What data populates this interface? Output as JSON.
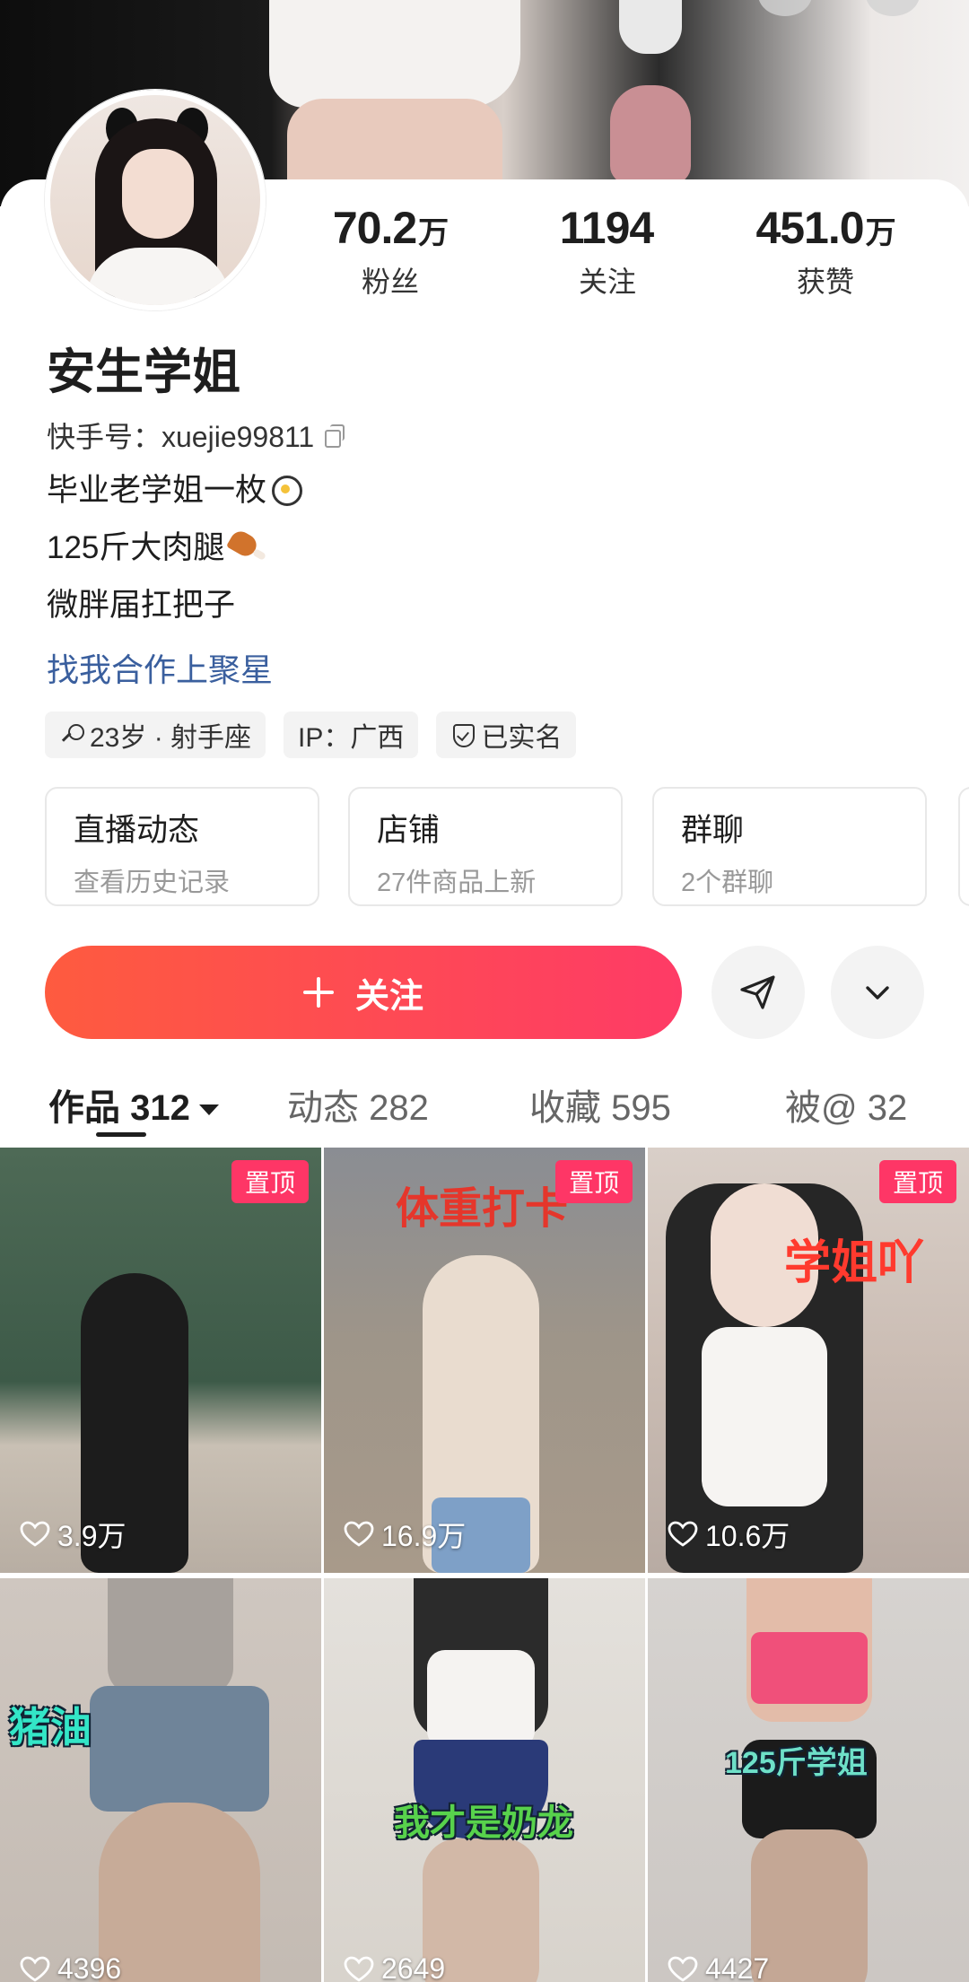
{
  "profile": {
    "name": "安生学姐",
    "kuaishou_id": "快手号：xuejie99811",
    "bio": [
      "毕业老学姐一枚",
      "125斤大肉腿",
      "微胖届扛把子"
    ],
    "cooperation_link": "找我合作上聚星"
  },
  "stats": [
    {
      "num": "70.2",
      "unit": "万",
      "label": "粉丝"
    },
    {
      "num": "1194",
      "unit": "",
      "label": "关注"
    },
    {
      "num": "451.0",
      "unit": "万",
      "label": "获赞"
    }
  ],
  "tags": [
    "23岁 · 射手座",
    "IP：广西",
    "已实名"
  ],
  "entries": [
    {
      "title": "直播动态",
      "subtitle": "查看历史记录"
    },
    {
      "title": "店铺",
      "subtitle": "27件商品上新"
    },
    {
      "title": "群聊",
      "subtitle": "2个群聊"
    }
  ],
  "follow_label": "关注",
  "tabs": [
    {
      "label": "作品 312"
    },
    {
      "label": "动态 282"
    },
    {
      "label": "收藏 595"
    },
    {
      "label": "被@ 32"
    }
  ],
  "videos": [
    {
      "likes": "3.9万",
      "pinned": "置顶",
      "caption": ""
    },
    {
      "likes": "16.9万",
      "pinned": "置顶",
      "caption": "体重打卡"
    },
    {
      "likes": "10.6万",
      "pinned": "置顶",
      "caption": "学姐吖"
    },
    {
      "likes": "4396",
      "pinned": "",
      "caption": "猪油"
    },
    {
      "likes": "2649",
      "pinned": "",
      "caption": "我才是奶龙"
    },
    {
      "likes": "4427",
      "pinned": "",
      "caption": "125斤学姐"
    }
  ],
  "colors": {
    "accent": "#fe3b66",
    "follow_start": "#fe5b3f",
    "link": "#3a5f9e"
  }
}
